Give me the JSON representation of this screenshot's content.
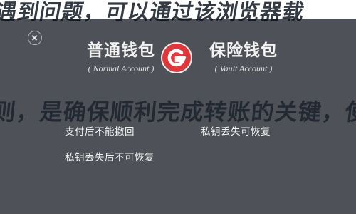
{
  "background_text": {
    "line_top": "遇到问题，可以通过该浏览器载",
    "line_mid": "则，是确保顺利完成转账的关键，使"
  },
  "dialog": {
    "normal_account": {
      "title": "普通钱包",
      "subtitle": "( Normal Account )"
    },
    "vault_account": {
      "title": "保险钱包",
      "subtitle": "( Vault Account )"
    },
    "options": [
      "支付后不能撤回",
      "私钥丢失可恢复",
      "私钥丢失后不可恢复"
    ]
  },
  "colors": {
    "overlay": "#0a0e16",
    "logo_red": "#e0383a",
    "text_light": "#f2f2f2"
  },
  "icons": {
    "close": "close-icon",
    "logo": "brand-logo-icon"
  }
}
